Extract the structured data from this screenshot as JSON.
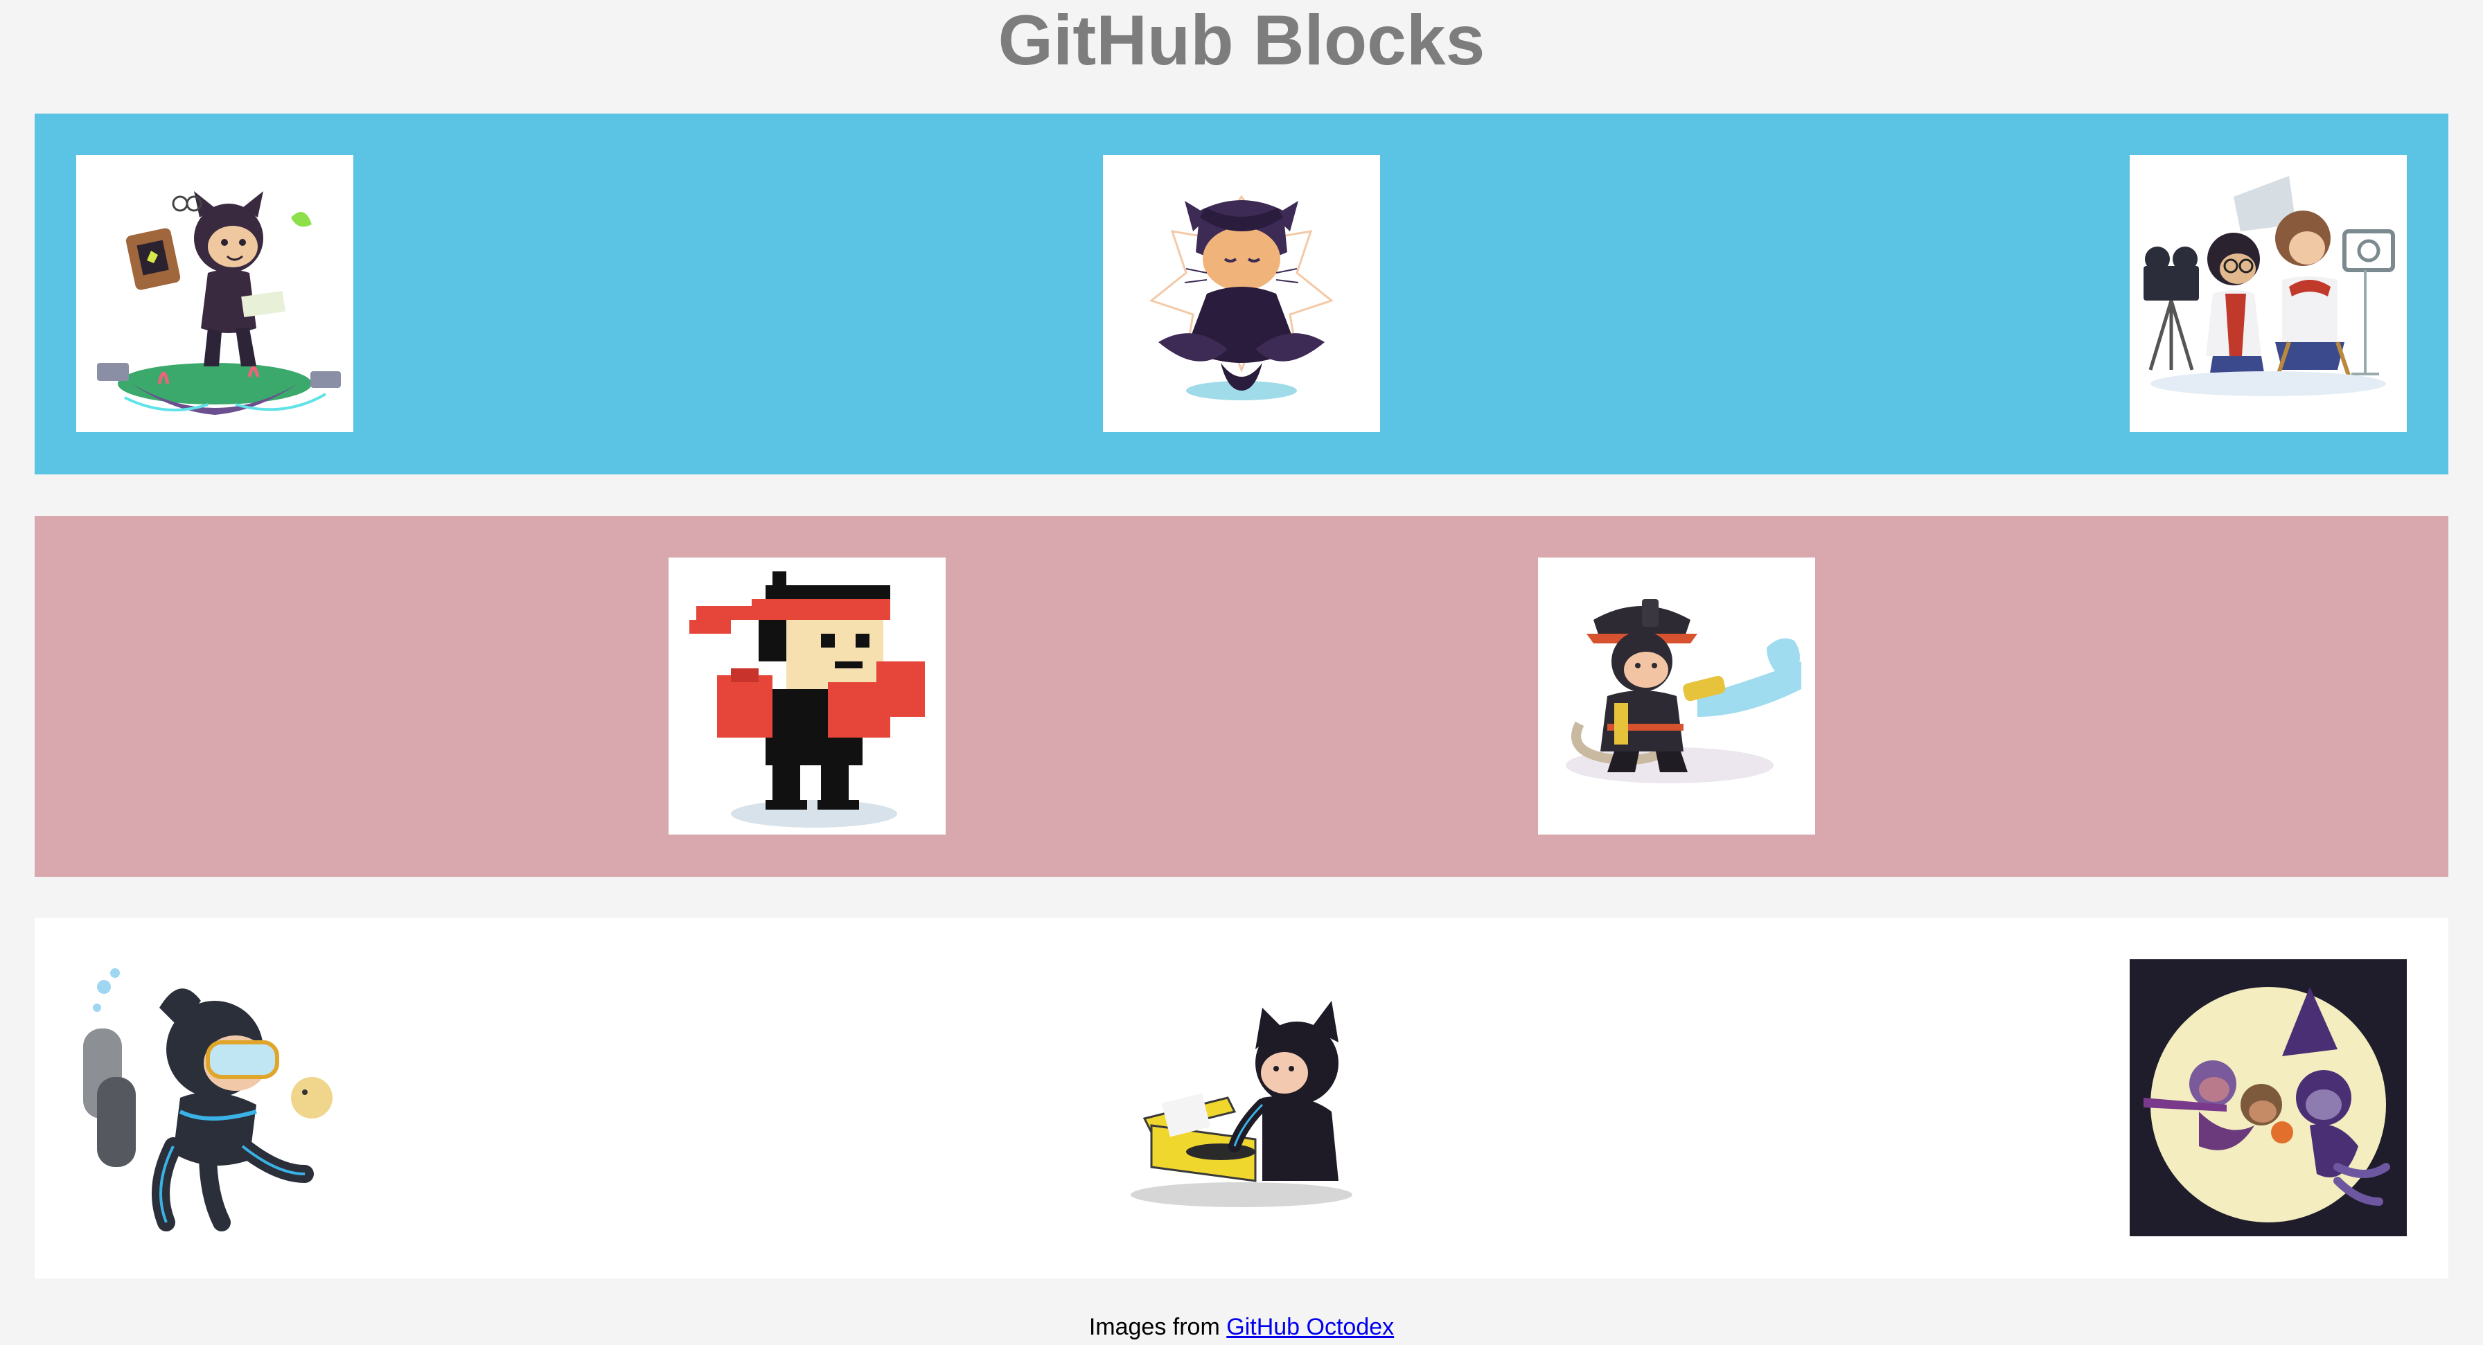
{
  "header": {
    "title": "GitHub Blocks"
  },
  "rows": [
    {
      "color": "#5bc3e3",
      "images": [
        {
          "icon": "octocat-gardener-floating-island-icon"
        },
        {
          "icon": "octocat-meditating-icon"
        },
        {
          "icon": "octocat-film-crew-icon"
        }
      ]
    },
    {
      "color": "#d8a8ae",
      "images": [
        {
          "icon": "octocat-pixel-boxer-icon"
        },
        {
          "icon": "octocat-firefighter-icon"
        }
      ]
    },
    {
      "color": "#ffffff",
      "images": [
        {
          "icon": "octocat-scuba-diver-icon"
        },
        {
          "icon": "octocat-record-player-icon"
        },
        {
          "icon": "octocat-witches-moon-icon"
        }
      ]
    }
  ],
  "footer": {
    "prefix": "Images from",
    "link_text": "GitHub Octodex"
  }
}
